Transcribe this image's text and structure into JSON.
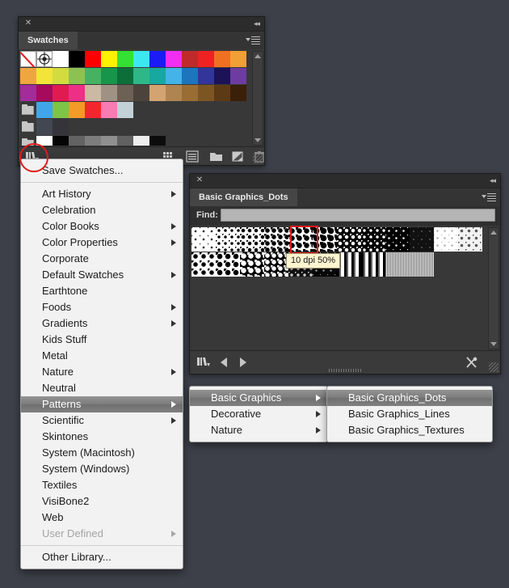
{
  "app": {
    "background_color": "#3d4049"
  },
  "swatches_panel": {
    "tab_label": "Swatches",
    "close_icon": "close-icon",
    "collapse_icon": "collapse-panel-icon",
    "menu_icon": "panel-menu-icon",
    "rows": [
      {
        "cells": [
          {
            "type": "none",
            "color": "#ffffff"
          },
          {
            "type": "registration",
            "color": "#ffffff"
          },
          {
            "type": "color",
            "color": "#ffffff"
          },
          {
            "type": "color",
            "color": "#000000"
          },
          {
            "type": "color",
            "color": "#ff0000"
          },
          {
            "type": "color",
            "color": "#fff200"
          },
          {
            "type": "color",
            "color": "#33e033"
          },
          {
            "type": "color",
            "color": "#3ce8f0"
          },
          {
            "type": "color",
            "color": "#1b1bf5"
          },
          {
            "type": "color",
            "color": "#f22ef2"
          },
          {
            "type": "color",
            "color": "#c02a2a"
          },
          {
            "type": "color",
            "color": "#ee2222"
          },
          {
            "type": "color",
            "color": "#f07022"
          },
          {
            "type": "color",
            "color": "#f0a035"
          }
        ]
      },
      {
        "cells": [
          {
            "type": "color",
            "color": "#f0a640"
          },
          {
            "type": "color",
            "color": "#f2e438"
          },
          {
            "type": "color",
            "color": "#d2dc3f"
          },
          {
            "type": "color",
            "color": "#8dc252"
          },
          {
            "type": "color",
            "color": "#46b261"
          },
          {
            "type": "color",
            "color": "#17954a"
          },
          {
            "type": "color",
            "color": "#0d6e3a"
          },
          {
            "type": "color",
            "color": "#2eb887"
          },
          {
            "type": "color",
            "color": "#17a8a0"
          },
          {
            "type": "color",
            "color": "#44b3e8"
          },
          {
            "type": "color",
            "color": "#1c75bd"
          },
          {
            "type": "color",
            "color": "#33359b"
          },
          {
            "type": "color",
            "color": "#1b1258"
          },
          {
            "type": "color",
            "color": "#6e3ba0"
          }
        ]
      },
      {
        "cells": [
          {
            "type": "color",
            "color": "#a22c9a"
          },
          {
            "type": "color",
            "color": "#a60a5d"
          },
          {
            "type": "color",
            "color": "#e01b52"
          },
          {
            "type": "color",
            "color": "#ee2f86"
          },
          {
            "type": "color",
            "color": "#cbb9a4"
          },
          {
            "type": "color",
            "color": "#9f9285"
          },
          {
            "type": "color",
            "color": "#6d6156"
          },
          {
            "type": "color",
            "color": "#4c443c"
          },
          {
            "type": "color",
            "color": "#d3a471"
          },
          {
            "type": "color",
            "color": "#b08450"
          },
          {
            "type": "color",
            "color": "#9a6d35"
          },
          {
            "type": "color",
            "color": "#7d5523"
          },
          {
            "type": "color",
            "color": "#5d3a16"
          },
          {
            "type": "color",
            "color": "#3a2008"
          }
        ]
      },
      {
        "cells": [
          {
            "type": "folder",
            "color": "#c6c6c6"
          },
          {
            "type": "color",
            "color": "#41a5ea"
          },
          {
            "type": "color",
            "color": "#7dc546"
          },
          {
            "type": "color",
            "color": "#f49a28"
          },
          {
            "type": "color",
            "color": "#f32630"
          },
          {
            "type": "color",
            "color": "#f97bb4"
          },
          {
            "type": "color",
            "color": "#c2d1d8"
          }
        ]
      },
      {
        "cells": [
          {
            "type": "folder",
            "color": "#c6c6c6"
          },
          {
            "type": "color",
            "color": "#434752"
          },
          {
            "type": "color",
            "color": "#34343a"
          }
        ]
      },
      {
        "cells": [
          {
            "type": "folder",
            "color": "#c6c6c6"
          },
          {
            "type": "color",
            "color": "#ffffff"
          },
          {
            "type": "color",
            "color": "#050505"
          },
          {
            "type": "color",
            "color": "#636363"
          },
          {
            "type": "color",
            "color": "#7d7d7d"
          },
          {
            "type": "color",
            "color": "#8f8f8f"
          },
          {
            "type": "color",
            "color": "#616161"
          },
          {
            "type": "color",
            "color": "#eeeeee"
          },
          {
            "type": "color",
            "color": "#0c0c0c"
          }
        ]
      }
    ],
    "scrollbar": {
      "up_icon": "scroll-up-arrow-icon",
      "down_icon": "scroll-down-arrow-icon"
    },
    "footer_icons": [
      "swatch-libraries-icon",
      "show-swatch-grid-icon",
      "show-swatch-list-icon",
      "new-color-group-icon",
      "new-swatch-icon",
      "delete-swatch-icon"
    ]
  },
  "swatch_menu": {
    "save_label": "Save Swatches...",
    "items": [
      {
        "label": "Art History",
        "submenu": true,
        "enabled": true,
        "selected": false
      },
      {
        "label": "Celebration",
        "submenu": false,
        "enabled": true,
        "selected": false
      },
      {
        "label": "Color Books",
        "submenu": true,
        "enabled": true,
        "selected": false
      },
      {
        "label": "Color Properties",
        "submenu": true,
        "enabled": true,
        "selected": false
      },
      {
        "label": "Corporate",
        "submenu": false,
        "enabled": true,
        "selected": false
      },
      {
        "label": "Default Swatches",
        "submenu": true,
        "enabled": true,
        "selected": false
      },
      {
        "label": "Earthtone",
        "submenu": false,
        "enabled": true,
        "selected": false
      },
      {
        "label": "Foods",
        "submenu": true,
        "enabled": true,
        "selected": false
      },
      {
        "label": "Gradients",
        "submenu": true,
        "enabled": true,
        "selected": false
      },
      {
        "label": "Kids Stuff",
        "submenu": false,
        "enabled": true,
        "selected": false
      },
      {
        "label": "Metal",
        "submenu": false,
        "enabled": true,
        "selected": false
      },
      {
        "label": "Nature",
        "submenu": true,
        "enabled": true,
        "selected": false
      },
      {
        "label": "Neutral",
        "submenu": false,
        "enabled": true,
        "selected": false
      },
      {
        "label": "Patterns",
        "submenu": true,
        "enabled": true,
        "selected": true
      },
      {
        "label": "Scientific",
        "submenu": true,
        "enabled": true,
        "selected": false
      },
      {
        "label": "Skintones",
        "submenu": false,
        "enabled": true,
        "selected": false
      },
      {
        "label": "System (Macintosh)",
        "submenu": false,
        "enabled": true,
        "selected": false
      },
      {
        "label": "System (Windows)",
        "submenu": false,
        "enabled": true,
        "selected": false
      },
      {
        "label": "Textiles",
        "submenu": false,
        "enabled": true,
        "selected": false
      },
      {
        "label": "VisiBone2",
        "submenu": false,
        "enabled": true,
        "selected": false
      },
      {
        "label": "Web",
        "submenu": false,
        "enabled": true,
        "selected": false
      },
      {
        "label": "User Defined",
        "submenu": true,
        "enabled": false,
        "selected": false
      }
    ],
    "other_label": "Other Library..."
  },
  "patterns_submenu": {
    "items": [
      {
        "label": "Basic Graphics",
        "submenu": true,
        "selected": true
      },
      {
        "label": "Decorative",
        "submenu": true,
        "selected": false
      },
      {
        "label": "Nature",
        "submenu": true,
        "selected": false
      }
    ]
  },
  "basic_graphics_submenu": {
    "items": [
      {
        "label": "Basic Graphics_Dots",
        "selected": true
      },
      {
        "label": "Basic Graphics_Lines",
        "selected": false
      },
      {
        "label": "Basic Graphics_Textures",
        "selected": false
      }
    ]
  },
  "patterns_panel": {
    "tab_label": "Basic Graphics_Dots",
    "close_icon": "close-icon",
    "collapse_icon": "collapse-panel-icon",
    "menu_icon": "panel-menu-icon",
    "find": {
      "label": "Find:",
      "value": "",
      "placeholder": ""
    },
    "selected_index": 4,
    "swatches": [
      {
        "name": "dots-tiny-1",
        "pattern": "dots-light",
        "dot": 2,
        "gap": 10,
        "fg": "#000000",
        "bg": "#ffffff"
      },
      {
        "name": "dots-small-2",
        "pattern": "dots-light",
        "dot": 3,
        "gap": 8,
        "fg": "#000000",
        "bg": "#ffffff"
      },
      {
        "name": "dots-med-3",
        "pattern": "dots-light",
        "dot": 4,
        "gap": 8,
        "fg": "#000000",
        "bg": "#ffffff"
      },
      {
        "name": "dots-large-4",
        "pattern": "dots-light",
        "dot": 5,
        "gap": 8,
        "fg": "#000000",
        "bg": "#ffffff"
      },
      {
        "name": "dots-xlarge-5",
        "pattern": "dots-light",
        "dot": 6,
        "gap": 9,
        "fg": "#000000",
        "bg": "#ffffff"
      },
      {
        "name": "dots-dense-6",
        "pattern": "dots-light",
        "dot": 7,
        "gap": 9,
        "fg": "#000000",
        "bg": "#ffffff"
      },
      {
        "name": "dots-inv-7",
        "pattern": "dots-dark",
        "dot": 4,
        "gap": 8,
        "fg": "#ffffff",
        "bg": "#000000"
      },
      {
        "name": "dots-inv-8",
        "pattern": "dots-dark",
        "dot": 3,
        "gap": 8,
        "fg": "#ffffff",
        "bg": "#000000"
      },
      {
        "name": "dots-inv-9",
        "pattern": "dots-dark",
        "dot": 2,
        "gap": 9,
        "fg": "#ffffff",
        "bg": "#000000"
      },
      {
        "name": "dots-faint-10",
        "pattern": "dots-dark",
        "dot": 1,
        "gap": 10,
        "fg": "#888888",
        "bg": "#111111"
      },
      {
        "name": "dots-pale-11",
        "pattern": "dots-light",
        "dot": 2,
        "gap": 9,
        "fg": "#b0b0b0",
        "bg": "#ffffff"
      },
      {
        "name": "dots-grey-12",
        "pattern": "dots-light",
        "dot": 3,
        "gap": 9,
        "fg": "#555555",
        "bg": "#f2f2f2"
      },
      {
        "name": "dots-bold-13",
        "pattern": "dots-light",
        "dot": 5,
        "gap": 10,
        "fg": "#000000",
        "bg": "#ffffff"
      },
      {
        "name": "dots-bold-14",
        "pattern": "dots-light",
        "dot": 6,
        "gap": 10,
        "fg": "#000000",
        "bg": "#ffffff"
      },
      {
        "name": "dots-check-15",
        "pattern": "dots-dark",
        "dot": 6,
        "gap": 9,
        "fg": "#ffffff",
        "bg": "#000000"
      },
      {
        "name": "dots-check-16",
        "pattern": "dots-dark",
        "dot": 5,
        "gap": 8,
        "fg": "#ffffff",
        "bg": "#000000"
      },
      {
        "name": "dots-check-17",
        "pattern": "dots-dark",
        "dot": 3,
        "gap": 8,
        "fg": "#cccccc",
        "bg": "#111111"
      },
      {
        "name": "dots-check-18",
        "pattern": "dots-dark",
        "dot": 2,
        "gap": 9,
        "fg": "#999999",
        "bg": "#080808"
      },
      {
        "name": "stripe-soft-19",
        "pattern": "stripes",
        "fg": "#000000",
        "bg": "#ffffff"
      },
      {
        "name": "stripe-hard-20",
        "pattern": "stripes",
        "fg": "#000000",
        "bg": "#ffffff"
      },
      {
        "name": "noise-21",
        "pattern": "noise",
        "fg": "#777777",
        "bg": "#e8e8e8"
      },
      {
        "name": "noise-22",
        "pattern": "noise",
        "fg": "#777777",
        "bg": "#e8e8e8"
      }
    ],
    "tooltip": {
      "text": "10 dpi 50%"
    },
    "footer_icons": [
      "pattern-libraries-icon",
      "previous-pattern-icon",
      "next-pattern-icon",
      "pin-pattern-icon"
    ],
    "scrollbar": {
      "up_icon": "scroll-up-arrow-icon",
      "down_icon": "scroll-down-arrow-icon"
    }
  },
  "annotations": {
    "swatch_libraries_highlight": "red-circle-highlight",
    "selected_pattern_highlight": "red-rect-highlight",
    "highlight_color": "#e01b1b"
  }
}
